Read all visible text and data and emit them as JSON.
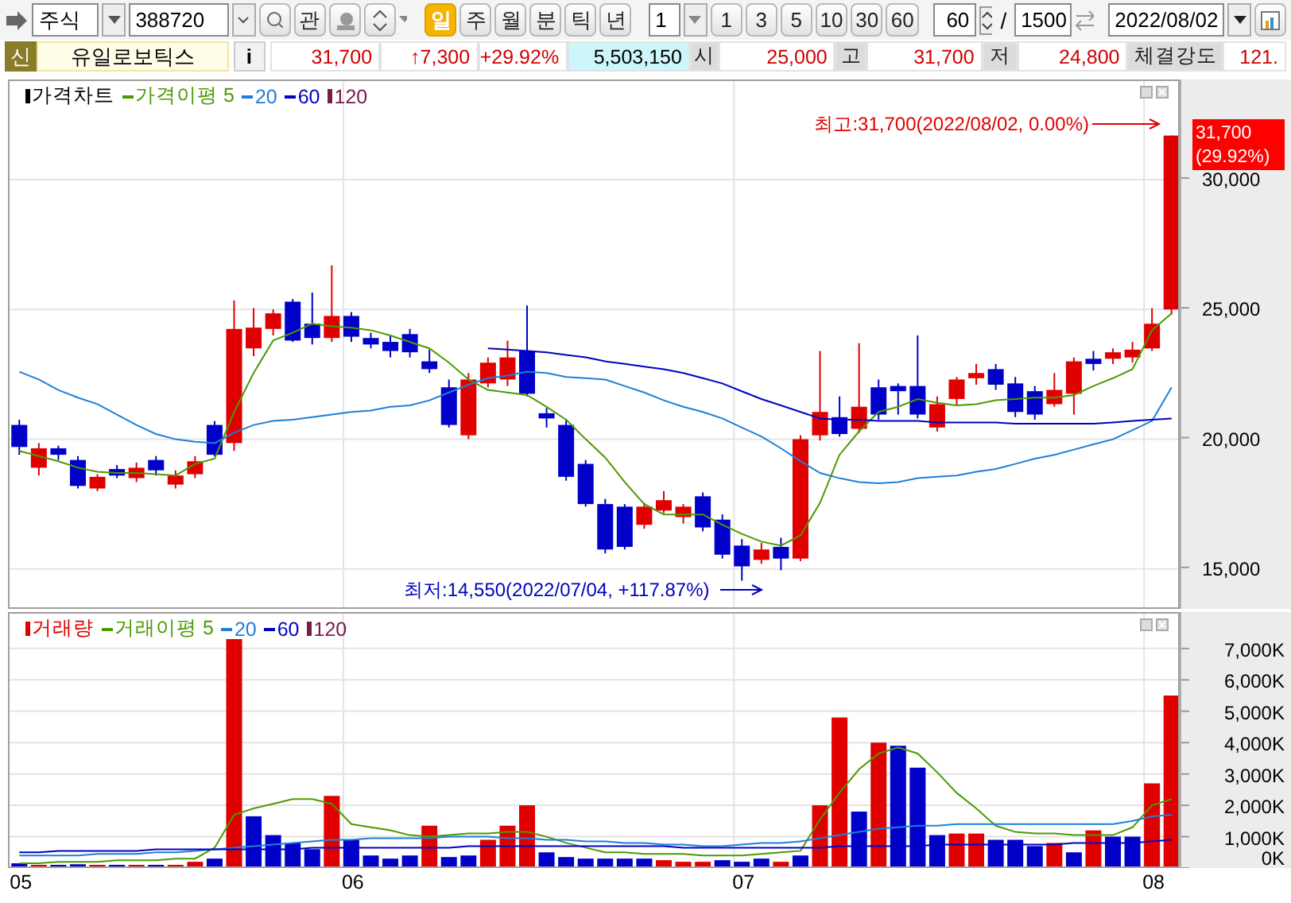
{
  "toolbar": {
    "market_select": "주식",
    "code_field": "388720",
    "watch_button": "관",
    "periods": [
      {
        "label": "일",
        "selected": true
      },
      {
        "label": "주",
        "selected": false
      },
      {
        "label": "월",
        "selected": false
      },
      {
        "label": "분",
        "selected": false
      },
      {
        "label": "틱",
        "selected": false
      },
      {
        "label": "년",
        "selected": false
      }
    ],
    "interval_select": "1",
    "intervals": [
      "1",
      "3",
      "5",
      "10",
      "30",
      "60"
    ],
    "count_field": "60",
    "separator": "/",
    "total_field": "1500",
    "date_field": "2022/08/02"
  },
  "quote_bar": {
    "badge": "신",
    "name": "유일로보틱스",
    "info_button": "i",
    "cells": [
      {
        "kind": "up",
        "text": "31,700"
      },
      {
        "kind": "up",
        "text": "↑7,300"
      },
      {
        "kind": "up",
        "text": "+29.92%"
      },
      {
        "kind": "volume",
        "text": "5,503,150"
      },
      {
        "kind": "label",
        "text": "시"
      },
      {
        "kind": "up",
        "text": "25,000"
      },
      {
        "kind": "label",
        "text": "고"
      },
      {
        "kind": "up",
        "text": "31,700"
      },
      {
        "kind": "label",
        "text": "저"
      },
      {
        "kind": "up",
        "text": "24,800"
      },
      {
        "kind": "label",
        "text": "체결강도"
      },
      {
        "kind": "up",
        "text": "121."
      }
    ]
  },
  "price_chart": {
    "legend_head": {
      "label": "가격차트",
      "color": "#000000"
    },
    "legend_tail": {
      "label": "120",
      "color": "#7a1a4a"
    },
    "high_note": "최고:31,700(2022/08/02, 0.00%)",
    "low_note": "최저:14,550(2022/07/04, +117.87%)",
    "current_badge": [
      "31,700",
      "(29.92%)"
    ],
    "chart_data": {
      "type": "candlestick",
      "ylim": [
        13400,
        33800
      ],
      "grid": true,
      "legend": "top-left",
      "ohlc": [
        [
          20550,
          20750,
          19400,
          19700
        ],
        [
          18900,
          19850,
          18600,
          19650
        ],
        [
          19650,
          19750,
          19200,
          19400
        ],
        [
          19200,
          19350,
          18100,
          18200
        ],
        [
          18100,
          18650,
          18000,
          18550
        ],
        [
          18850,
          19000,
          18500,
          18600
        ],
        [
          18500,
          19100,
          18350,
          18900
        ],
        [
          19200,
          19350,
          18600,
          18800
        ],
        [
          18250,
          18800,
          18100,
          18600
        ],
        [
          18650,
          19350,
          18500,
          19150
        ],
        [
          20550,
          20700,
          19350,
          19400
        ],
        [
          19850,
          25350,
          19550,
          24250
        ],
        [
          23500,
          25050,
          23200,
          24300
        ],
        [
          24250,
          25000,
          24000,
          24850
        ],
        [
          25300,
          25400,
          23750,
          23800
        ],
        [
          24450,
          25650,
          23650,
          23900
        ],
        [
          23900,
          26700,
          23750,
          24750
        ],
        [
          24750,
          24900,
          23750,
          23950
        ],
        [
          23900,
          24100,
          23500,
          23650
        ],
        [
          23750,
          24000,
          23150,
          23400
        ],
        [
          24050,
          24250,
          23150,
          23350
        ],
        [
          23000,
          23450,
          22550,
          22700
        ],
        [
          22000,
          22300,
          20450,
          20550
        ],
        [
          20150,
          22550,
          20000,
          22300
        ],
        [
          22150,
          23150,
          22000,
          22950
        ],
        [
          22300,
          23800,
          22050,
          23150
        ],
        [
          23400,
          25150,
          21650,
          21750
        ],
        [
          21000,
          21200,
          20450,
          20800
        ],
        [
          20550,
          20750,
          18400,
          18550
        ],
        [
          19050,
          19200,
          17400,
          17500
        ],
        [
          17500,
          17700,
          15600,
          15750
        ],
        [
          17400,
          17500,
          15750,
          15850
        ],
        [
          16700,
          17550,
          16550,
          17400
        ],
        [
          17250,
          18000,
          17150,
          17650
        ],
        [
          17000,
          17500,
          16750,
          17400
        ],
        [
          17800,
          17950,
          16450,
          16600
        ],
        [
          16900,
          17100,
          15400,
          15550
        ],
        [
          15900,
          16150,
          14550,
          15100
        ],
        [
          15350,
          16000,
          15200,
          15750
        ],
        [
          15850,
          16200,
          14950,
          15400
        ],
        [
          15400,
          20150,
          15300,
          20000
        ],
        [
          20150,
          23400,
          19950,
          21050
        ],
        [
          20850,
          21650,
          20100,
          20200
        ],
        [
          20400,
          23700,
          20250,
          21250
        ],
        [
          22000,
          22300,
          20750,
          20950
        ],
        [
          22050,
          22150,
          20950,
          21850
        ],
        [
          22050,
          24000,
          20800,
          20950
        ],
        [
          20450,
          21650,
          20300,
          21350
        ],
        [
          21550,
          22400,
          21300,
          22300
        ],
        [
          22350,
          22900,
          22100,
          22550
        ],
        [
          22700,
          22900,
          21900,
          22100
        ],
        [
          22150,
          22400,
          20850,
          21050
        ],
        [
          21850,
          22050,
          20750,
          20950
        ],
        [
          21350,
          22550,
          21250,
          21900
        ],
        [
          21750,
          23150,
          20950,
          23000
        ],
        [
          23100,
          23400,
          22650,
          22900
        ],
        [
          23100,
          23500,
          22900,
          23350
        ],
        [
          23150,
          23750,
          22950,
          23450
        ],
        [
          23500,
          25050,
          23400,
          24450
        ],
        [
          25000,
          31700,
          24800,
          31700
        ]
      ],
      "yticks": [
        {
          "value": 30000,
          "label": "30,000"
        },
        {
          "value": 25000,
          "label": "25,000"
        },
        {
          "value": 20000,
          "label": "20,000"
        },
        {
          "value": 15000,
          "label": "15,000"
        }
      ],
      "series": [
        {
          "name": "가격이평 5",
          "type": "line",
          "color": "#4c9a00",
          "values": [
            19550,
            19350,
            19150,
            18900,
            18750,
            18700,
            18700,
            18650,
            18600,
            19050,
            19250,
            21050,
            22550,
            23800,
            24100,
            24450,
            24350,
            24300,
            24200,
            24000,
            23750,
            23500,
            22950,
            22300,
            21900,
            21800,
            21700,
            21250,
            20750,
            20000,
            19300,
            18350,
            17500,
            17100,
            17100,
            17100,
            16700,
            16350,
            16050,
            15900,
            16300,
            17550,
            19400,
            20300,
            21050,
            21250,
            21550,
            21400,
            21300,
            21350,
            21500,
            21550,
            21600,
            21600,
            21700,
            22050,
            22350,
            22700,
            24200,
            24850
          ]
        },
        {
          "name": "20",
          "type": "line",
          "color": "#1e7fd8",
          "values": [
            22600,
            22300,
            21900,
            21600,
            21350,
            20950,
            20550,
            20200,
            20000,
            19900,
            19850,
            20250,
            20550,
            20700,
            20750,
            20850,
            20950,
            21050,
            21100,
            21250,
            21300,
            21500,
            21800,
            22100,
            22350,
            22450,
            22600,
            22550,
            22400,
            22350,
            22300,
            22050,
            21800,
            21500,
            21250,
            21050,
            20800,
            20450,
            20100,
            19650,
            19150,
            18700,
            18500,
            18350,
            18300,
            18350,
            18500,
            18550,
            18600,
            18750,
            18850,
            19050,
            19250,
            19400,
            19600,
            19800,
            20000,
            20350,
            20700,
            22000
          ]
        },
        {
          "name": "60",
          "type": "line",
          "color": "#0000c0",
          "values": [
            null,
            null,
            null,
            null,
            null,
            null,
            null,
            null,
            null,
            null,
            null,
            null,
            null,
            null,
            null,
            null,
            null,
            null,
            null,
            null,
            null,
            null,
            null,
            null,
            23500,
            23450,
            23400,
            23350,
            23250,
            23150,
            23000,
            22900,
            22800,
            22700,
            22550,
            22350,
            22150,
            21850,
            21550,
            21300,
            21050,
            20800,
            20750,
            20750,
            20700,
            20700,
            20700,
            20650,
            20650,
            20650,
            20650,
            20600,
            20600,
            20600,
            20600,
            20600,
            20650,
            20700,
            20750,
            20800
          ]
        }
      ]
    }
  },
  "volume_chart": {
    "legend_tail": {
      "label": "120",
      "color": "#7a1a4a"
    },
    "x_labels": [
      "05",
      "06",
      "07",
      "08"
    ],
    "chart_data": {
      "type": "bar",
      "ylim": [
        0,
        7300
      ],
      "grid": true,
      "legend": "top-left",
      "yticks": [
        {
          "value": 0,
          "label": "0K"
        },
        {
          "value": 1000,
          "label": "1,000K"
        },
        {
          "value": 2000,
          "label": "2,000K"
        },
        {
          "value": 3000,
          "label": "3,000K"
        },
        {
          "value": 4000,
          "label": "4,000K"
        },
        {
          "value": 5000,
          "label": "5,000K"
        },
        {
          "value": 6000,
          "label": "6,000K"
        },
        {
          "value": 7000,
          "label": "7,000K"
        }
      ],
      "series": [
        {
          "name": "거래량",
          "color": "#e00000",
          "colors": [
            "#0000c8",
            "#e00000",
            "#0000c8",
            "#0000c8",
            "#e00000",
            "#0000c8",
            "#e00000",
            "#0000c8",
            "#e00000",
            "#e00000",
            "#0000c8",
            "#e00000",
            "#0000c8",
            "#0000c8",
            "#0000c8",
            "#0000c8",
            "#e00000",
            "#0000c8",
            "#0000c8",
            "#0000c8",
            "#0000c8",
            "#e00000",
            "#0000c8",
            "#0000c8",
            "#e00000",
            "#e00000",
            "#e00000",
            "#0000c8",
            "#0000c8",
            "#0000c8",
            "#0000c8",
            "#0000c8",
            "#0000c8",
            "#e00000",
            "#e00000",
            "#e00000",
            "#0000c8",
            "#0000c8",
            "#0000c8",
            "#e00000",
            "#0000c8",
            "#e00000",
            "#e00000",
            "#0000c8",
            "#e00000",
            "#0000c8",
            "#0000c8",
            "#0000c8",
            "#e00000",
            "#e00000",
            "#0000c8",
            "#0000c8",
            "#0000c8",
            "#e00000",
            "#0000c8",
            "#e00000",
            "#0000c8",
            "#0000c8",
            "#e00000",
            "#e00000"
          ],
          "values": [
            150,
            100,
            100,
            120,
            80,
            60,
            80,
            80,
            100,
            200,
            300,
            7300,
            1650,
            1050,
            800,
            600,
            2300,
            900,
            400,
            300,
            400,
            1350,
            350,
            400,
            900,
            1350,
            2000,
            500,
            350,
            300,
            300,
            300,
            300,
            250,
            200,
            200,
            250,
            200,
            300,
            200,
            400,
            2000,
            4800,
            1800,
            4000,
            3900,
            3200,
            1050,
            1100,
            1100,
            900,
            900,
            700,
            800,
            500,
            1200,
            1000,
            1000,
            2700,
            5500
          ]
        },
        {
          "name": "거래이평 5",
          "type": "line",
          "color": "#4c9a00",
          "values": [
            150,
            150,
            200,
            200,
            200,
            250,
            250,
            250,
            300,
            300,
            650,
            1700,
            1900,
            2050,
            2200,
            2200,
            2050,
            1400,
            1300,
            1200,
            1050,
            1000,
            1050,
            1100,
            1100,
            1150,
            1150,
            1000,
            800,
            650,
            500,
            500,
            450,
            450,
            450,
            400,
            400,
            400,
            450,
            500,
            550,
            1550,
            2400,
            3150,
            3650,
            3850,
            3650,
            3050,
            2400,
            1900,
            1350,
            1150,
            1100,
            1100,
            1050,
            1050,
            1050,
            1300,
            2000,
            2200
          ]
        },
        {
          "name": "20",
          "type": "line",
          "color": "#1e7fd8",
          "values": [
            400,
            400,
            400,
            400,
            450,
            450,
            450,
            500,
            500,
            550,
            600,
            650,
            700,
            750,
            800,
            850,
            900,
            900,
            950,
            950,
            950,
            950,
            1000,
            1000,
            1000,
            950,
            950,
            900,
            900,
            850,
            850,
            800,
            800,
            750,
            750,
            700,
            700,
            750,
            800,
            800,
            850,
            950,
            1050,
            1150,
            1250,
            1300,
            1350,
            1350,
            1400,
            1400,
            1400,
            1400,
            1400,
            1400,
            1400,
            1400,
            1400,
            1500,
            1650,
            1700
          ]
        },
        {
          "name": "60",
          "type": "line",
          "color": "#0000c0",
          "values": [
            500,
            500,
            550,
            550,
            550,
            550,
            550,
            600,
            600,
            600,
            600,
            600,
            600,
            600,
            600,
            650,
            650,
            650,
            650,
            650,
            650,
            650,
            650,
            700,
            700,
            700,
            700,
            700,
            700,
            700,
            700,
            700,
            700,
            700,
            650,
            650,
            650,
            650,
            650,
            650,
            650,
            650,
            700,
            700,
            700,
            700,
            700,
            750,
            750,
            750,
            750,
            750,
            750,
            750,
            800,
            800,
            800,
            800,
            850,
            900
          ]
        }
      ]
    }
  }
}
